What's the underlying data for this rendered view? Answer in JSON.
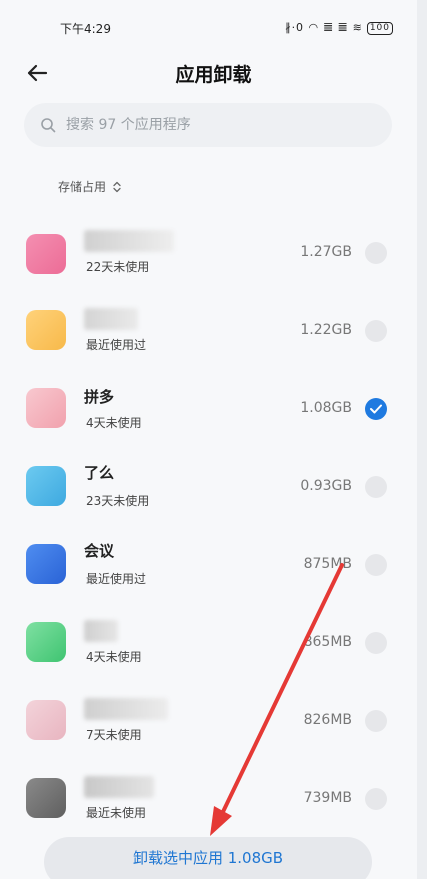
{
  "status": {
    "time": "下午4:29",
    "icons": "∦·0 ◠ 𝍤 𝍤 ≋",
    "battery": "100"
  },
  "header": {
    "title": "应用卸载"
  },
  "search": {
    "placeholder": "搜索 97 个应用程序"
  },
  "sort": {
    "label": "存储占用"
  },
  "apps": [
    {
      "name": "",
      "usage": "22天未使用",
      "size": "1.27GB",
      "checked": false
    },
    {
      "name": "",
      "usage": "最近使用过",
      "size": "1.22GB",
      "checked": false
    },
    {
      "name": "拼多",
      "usage": "4天未使用",
      "size": "1.08GB",
      "checked": true
    },
    {
      "name": "了么",
      "usage": "23天未使用",
      "size": "0.93GB",
      "checked": false
    },
    {
      "name": "会议",
      "usage": "最近使用过",
      "size": "875MB",
      "checked": false
    },
    {
      "name": "",
      "usage": "4天未使用",
      "size": "865MB",
      "checked": false
    },
    {
      "name": "",
      "usage": "7天未使用",
      "size": "826MB",
      "checked": false
    },
    {
      "name": "",
      "usage": "最近未使用",
      "size": "739MB",
      "checked": false
    }
  ],
  "footer": {
    "button_label": "卸载选中应用 1.08GB"
  },
  "colors": {
    "accent": "#1f7ae0",
    "annotation_arrow": "#e53935"
  }
}
